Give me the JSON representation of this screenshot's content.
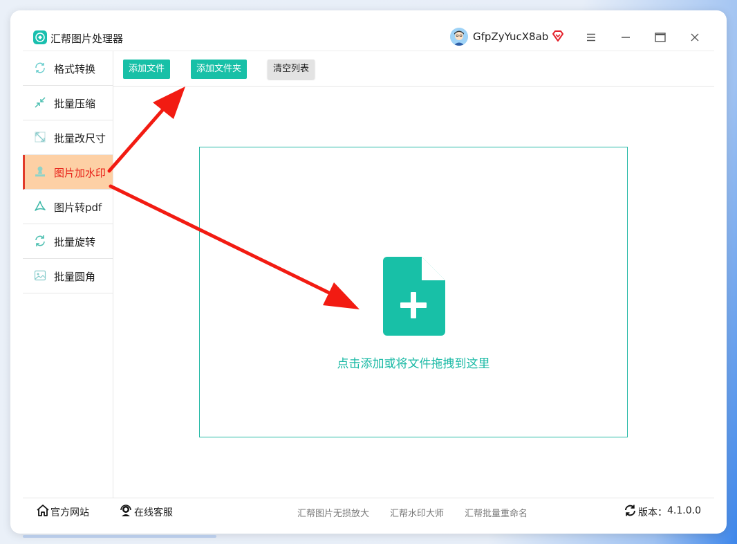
{
  "window": {
    "title": "汇帮图片处理器",
    "username": "GfpZyYucX8ab"
  },
  "sidebar": {
    "items": [
      {
        "label": "格式转换"
      },
      {
        "label": "批量压缩"
      },
      {
        "label": "批量改尺寸"
      },
      {
        "label": "图片加水印",
        "active": true
      },
      {
        "label": "图片转pdf"
      },
      {
        "label": "批量旋转"
      },
      {
        "label": "批量圆角"
      }
    ]
  },
  "toolbar": {
    "add_file": "添加文件",
    "add_folder": "添加文件夹",
    "clear_list": "清空列表"
  },
  "dropzone": {
    "hint": "点击添加或将文件拖拽到这里"
  },
  "footer": {
    "website": "官方网站",
    "support": "在线客服",
    "links": [
      "汇帮图片无损放大",
      "汇帮水印大师",
      "汇帮批量重命名"
    ],
    "version_label": "版本：",
    "version": "4.1.0.0"
  },
  "colors": {
    "accent": "#18c0a7",
    "active_bg": "#fdd0a5",
    "active_text": "#e8231a",
    "annotation_arrow": "#f21b12"
  }
}
